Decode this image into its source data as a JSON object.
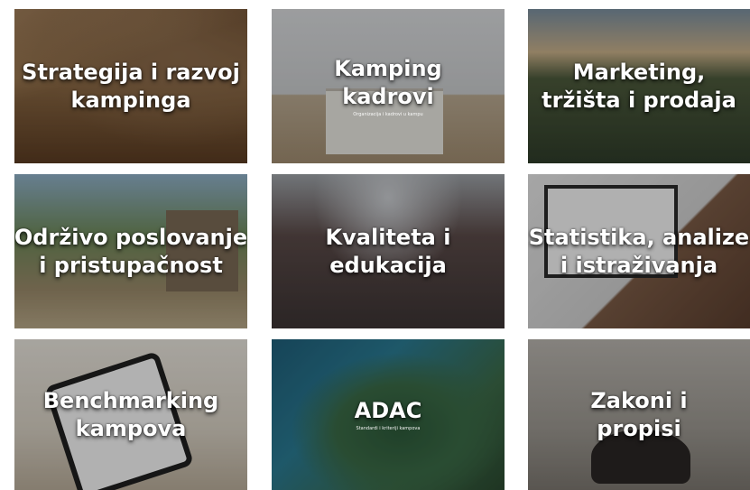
{
  "tiles": [
    {
      "lines": [
        "Strategija i razvoj",
        "kampinga"
      ],
      "subtitle": "",
      "icon": "camping-interior-photo"
    },
    {
      "lines": [
        "Kamping",
        "kadrovi"
      ],
      "subtitle": "Organizacija i kadrovi u kampu",
      "icon": "reception-desk-photo"
    },
    {
      "lines": [
        "Marketing,",
        "tržišta i prodaja"
      ],
      "subtitle": "",
      "icon": "coastal-camp-photo"
    },
    {
      "lines": [
        "Održivo poslovanje",
        "i pristupačnost"
      ],
      "subtitle": "",
      "icon": "mobile-home-photo"
    },
    {
      "lines": [
        "Kvaliteta i",
        "edukacija"
      ],
      "subtitle": "",
      "icon": "conference-audience-photo"
    },
    {
      "lines": [
        "Statistika, analize",
        "i istraživanja"
      ],
      "subtitle": "",
      "icon": "analytics-laptop-photo"
    },
    {
      "lines": [
        "Benchmarking",
        "kampova"
      ],
      "subtitle": "",
      "icon": "tablet-chart-photo"
    },
    {
      "lines": [
        "ADAC"
      ],
      "subtitle": "Standardi i kriteriji kampova",
      "icon": "aerial-island-photo"
    },
    {
      "lines": [
        "Zakoni i",
        "propisi"
      ],
      "subtitle": "",
      "icon": "judge-gavel-photo"
    }
  ]
}
